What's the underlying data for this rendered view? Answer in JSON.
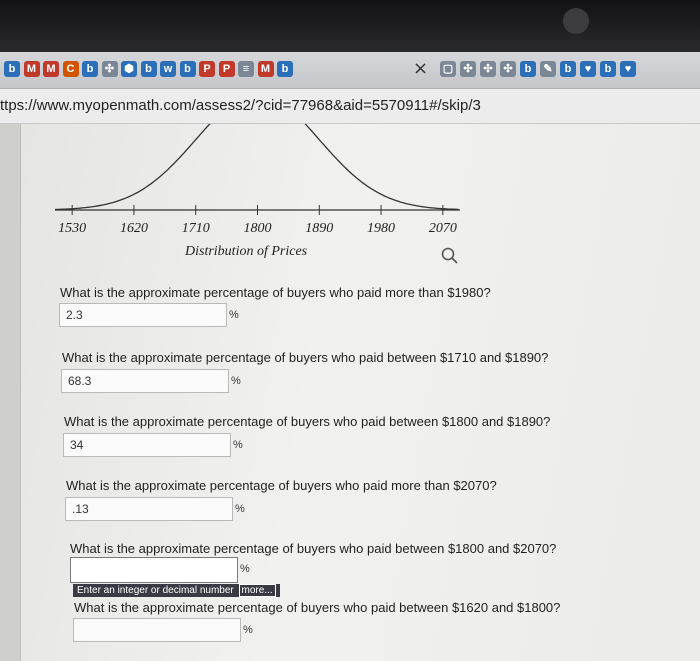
{
  "browser": {
    "url": "ttps://www.myopenmath.com/assess2/?cid=77968&aid=5570911#/skip/3",
    "tab_icons": [
      {
        "glyph": "b",
        "color": "#2a6fb8"
      },
      {
        "glyph": "M",
        "color": "#c0392b"
      },
      {
        "glyph": "M",
        "color": "#c0392b"
      },
      {
        "glyph": "C",
        "color": "#d35400"
      },
      {
        "glyph": "b",
        "color": "#2a6fb8"
      },
      {
        "glyph": "✣",
        "color": "#7b8794"
      },
      {
        "glyph": "⬢",
        "color": "#2a6fb8"
      },
      {
        "glyph": "b",
        "color": "#2a6fb8"
      },
      {
        "glyph": "w",
        "color": "#2a6fb8"
      },
      {
        "glyph": "b",
        "color": "#2a6fb8"
      },
      {
        "glyph": "P",
        "color": "#c0392b"
      },
      {
        "glyph": "P",
        "color": "#c0392b"
      },
      {
        "glyph": "≡",
        "color": "#7b8794"
      },
      {
        "glyph": "M",
        "color": "#c0392b"
      },
      {
        "glyph": "b",
        "color": "#2a6fb8"
      }
    ],
    "right_icons": [
      {
        "glyph": "▢",
        "color": "#7b8794"
      },
      {
        "glyph": "✣",
        "color": "#7b8794"
      },
      {
        "glyph": "✣",
        "color": "#7b8794"
      },
      {
        "glyph": "✣",
        "color": "#7b8794"
      },
      {
        "glyph": "b",
        "color": "#2a6fb8"
      },
      {
        "glyph": "✎",
        "color": "#7b8794"
      },
      {
        "glyph": "b",
        "color": "#2a6fb8"
      },
      {
        "glyph": "♥",
        "color": "#2a6fb8"
      },
      {
        "glyph": "b",
        "color": "#2a6fb8"
      },
      {
        "glyph": "♥",
        "color": "#2a6fb8"
      }
    ]
  },
  "chart_data": {
    "type": "line",
    "title": "Distribution of Prices",
    "xlabel": "Distribution of Prices",
    "ticks": [
      1530,
      1620,
      1710,
      1800,
      1890,
      1980,
      2070
    ],
    "xlim": [
      1505,
      2095
    ],
    "curve": "normal",
    "mean": 1800,
    "sd": 90,
    "grid": false
  },
  "questions": [
    {
      "text": "What is the approximate percentage of buyers who paid more than $1980?",
      "value": "2.3",
      "unit": "%"
    },
    {
      "text": "What is the approximate percentage of buyers who paid between $1710 and $1890?",
      "value": "68.3",
      "unit": "%"
    },
    {
      "text": "What is the approximate percentage of buyers who paid between $1800 and $1890?",
      "value": "34",
      "unit": "%"
    },
    {
      "text": "What is the approximate percentage of buyers who paid more than $2070?",
      "value": ".13",
      "unit": "%"
    },
    {
      "text": "What is the approximate percentage of buyers who paid between $1800 and $2070?",
      "value": "",
      "unit": "%"
    },
    {
      "text": "What is the approximate percentage of buyers who paid between $1620 and $1800?",
      "value": "",
      "unit": "%"
    }
  ],
  "hint": {
    "text": "Enter an integer or decimal number",
    "more": "more..."
  }
}
